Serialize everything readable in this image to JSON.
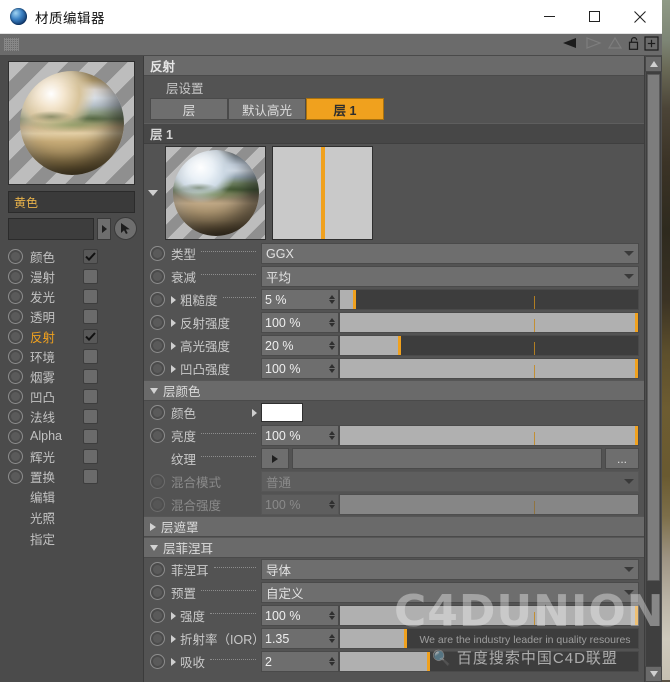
{
  "window": {
    "title": "材质编辑器",
    "icon": "c4d-material-icon",
    "minimize": "−",
    "maximize": "□",
    "close": "✕"
  },
  "toolbar": {
    "grip": "drag-grip-icon",
    "icons": [
      "nav-back-icon",
      "nav-forward-icon",
      "nav-up-icon",
      "lock-icon",
      "add-icon"
    ]
  },
  "sidebar": {
    "preview_name": "material-preview-sphere",
    "name_value": "黄色",
    "link_value": "",
    "link_arrow": "▸",
    "pick_icon": "cursor-pick-icon",
    "channels": [
      {
        "label": "颜色",
        "checked": true,
        "active": false
      },
      {
        "label": "漫射",
        "checked": false,
        "active": false
      },
      {
        "label": "发光",
        "checked": false,
        "active": false
      },
      {
        "label": "透明",
        "checked": false,
        "active": false
      },
      {
        "label": "反射",
        "checked": true,
        "active": true
      },
      {
        "label": "环境",
        "checked": false,
        "active": false
      },
      {
        "label": "烟雾",
        "checked": false,
        "active": false
      },
      {
        "label": "凹凸",
        "checked": false,
        "active": false
      },
      {
        "label": "法线",
        "checked": false,
        "active": false
      },
      {
        "label": "Alpha",
        "checked": false,
        "active": false
      },
      {
        "label": "辉光",
        "checked": false,
        "active": false
      },
      {
        "label": "置换",
        "checked": false,
        "active": false
      }
    ],
    "commands": [
      "编辑",
      "光照",
      "指定"
    ]
  },
  "main": {
    "section_title": "反射",
    "layer_settings_label": "层设置",
    "tabs": [
      {
        "label": "层",
        "selected": false
      },
      {
        "label": "默认高光",
        "selected": false
      },
      {
        "label": "层 1",
        "selected": true
      }
    ],
    "layer_header": "层 1",
    "thumbnails": [
      "layer-preview-sphere",
      "layer-gradient-strip"
    ],
    "params": [
      {
        "label": "类型",
        "type": "dropdown",
        "value": "GGX",
        "indent": false,
        "disabled": false
      },
      {
        "label": "衰减",
        "type": "dropdown",
        "value": "平均",
        "indent": false,
        "disabled": false
      }
    ],
    "sliders": [
      {
        "label": "粗糙度",
        "value": "5 %",
        "fill": 5,
        "disabled": false
      },
      {
        "label": "反射强度",
        "value": "100 %",
        "fill": 100,
        "disabled": false
      },
      {
        "label": "高光强度",
        "value": "20 %",
        "fill": 20,
        "disabled": false
      },
      {
        "label": "凹凸强度",
        "value": "100 %",
        "fill": 100,
        "disabled": false
      }
    ],
    "layer_color": {
      "title": "层颜色",
      "expanded": true,
      "color_label": "颜色",
      "color_value": "#ffffff",
      "brightness_label": "亮度",
      "brightness_value": "100 %",
      "brightness_fill": 100,
      "texture_label": "纹理",
      "texture_value": "",
      "texture_browse": "...",
      "blend_mode_label": "混合模式",
      "blend_mode_value": "普通",
      "blend_strength_label": "混合强度",
      "blend_strength_value": "100 %",
      "blend_strength_fill": 100
    },
    "layer_mask": {
      "title": "层遮罩",
      "expanded": false
    },
    "layer_fresnel": {
      "title": "层菲涅耳",
      "expanded": true,
      "fresnel_label": "菲涅耳",
      "fresnel_value": "导体",
      "preset_label": "预置",
      "preset_value": "自定义",
      "strength_label": "强度",
      "strength_value": "100 %",
      "strength_fill": 100,
      "ior_label": "折射率（IOR）",
      "ior_value": "1.35",
      "ior_fill": 22,
      "absorb_label": "吸收",
      "absorb_value": "2",
      "absorb_fill": 30
    },
    "scrollbar": {
      "up": "▲",
      "down": "▼"
    }
  },
  "watermark": {
    "brand": "C4DUNION",
    "tagline": "We are the industry leader in quality resoures",
    "cn": "百度搜索中国C4D联盟",
    "search_icon": "search-icon"
  },
  "colors": {
    "accent": "#f0a11e",
    "panel": "#535353",
    "sidebar": "#4b4b4b",
    "header": "#6a6a6a"
  }
}
